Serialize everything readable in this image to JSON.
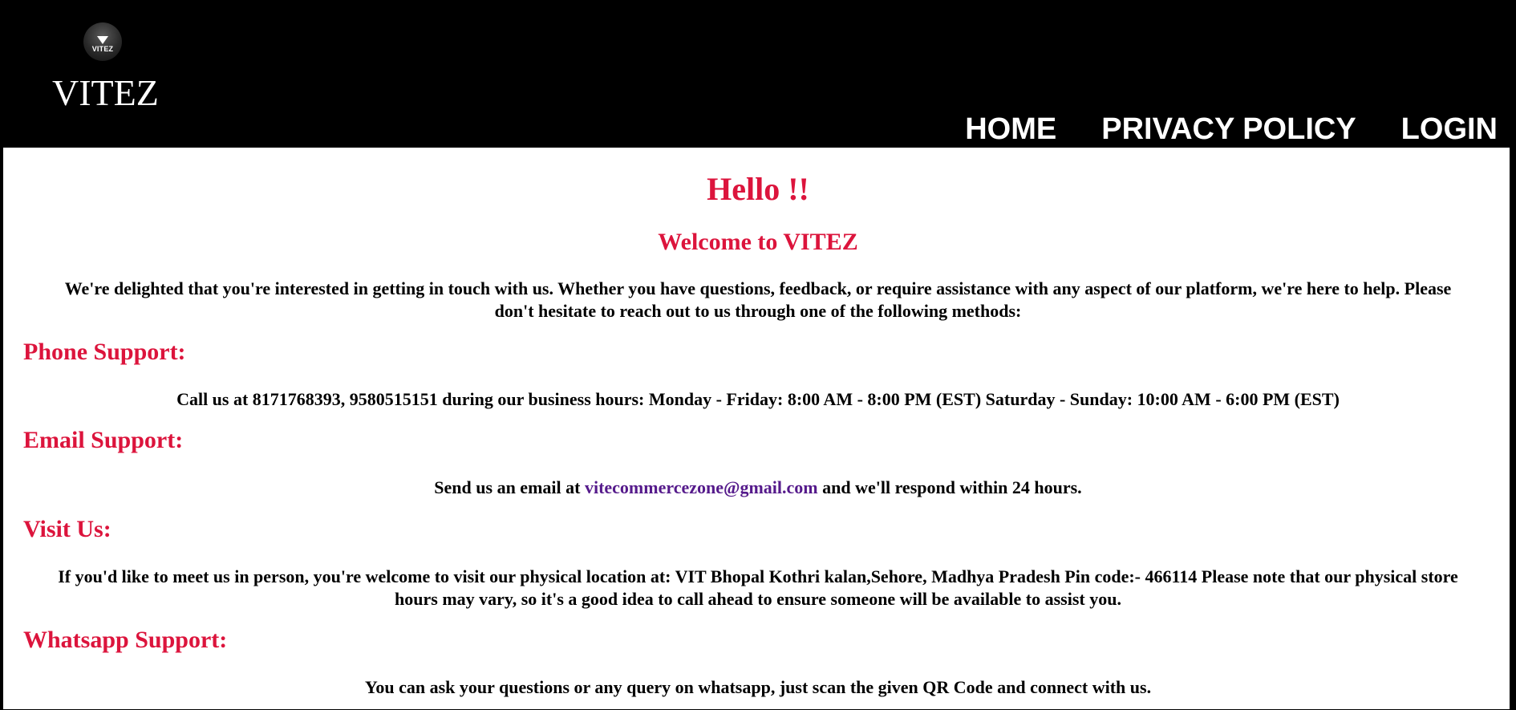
{
  "header": {
    "logo_text": "VITEZ",
    "brand": "VITEZ",
    "nav": {
      "home": "HOME",
      "privacy": "PRIVACY POLICY",
      "login": "LOGIN"
    }
  },
  "main": {
    "hello": "Hello !!",
    "welcome": "Welcome to VITEZ",
    "intro": "We're delighted that you're interested in getting in touch with us. Whether you have questions, feedback, or require assistance with any aspect of our platform, we're here to help. Please don't hesitate to reach out to us through one of the following methods:",
    "phone": {
      "title": "Phone Support:",
      "text": "Call us at 8171768393, 9580515151 during our business hours: Monday - Friday: 8:00 AM - 8:00 PM (EST) Saturday - Sunday: 10:00 AM - 6:00 PM (EST)"
    },
    "email": {
      "title": "Email Support:",
      "text_before": "Send us an email at ",
      "address": "vitecommercezone@gmail.com",
      "text_after": " and we'll respond within 24 hours."
    },
    "visit": {
      "title": "Visit Us:",
      "text": "If you'd like to meet us in person, you're welcome to visit our physical location at: VIT Bhopal Kothri kalan,Sehore, Madhya Pradesh Pin code:- 466114 Please note that our physical store hours may vary, so it's a good idea to call ahead to ensure someone will be available to assist you."
    },
    "whatsapp": {
      "title": "Whatsapp Support:",
      "text": "You can ask your questions or any query on whatsapp, just scan the given QR Code and connect with us."
    }
  },
  "colors": {
    "accent": "#dc143c",
    "link": "#551a8b",
    "header_bg": "#000000"
  }
}
